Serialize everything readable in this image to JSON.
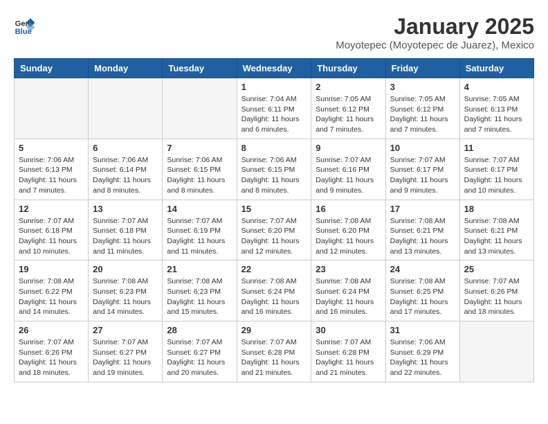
{
  "header": {
    "logo": {
      "general": "General",
      "blue": "Blue"
    },
    "title": "January 2025",
    "subtitle": "Moyotepec (Moyotepec de Juarez), Mexico"
  },
  "calendar": {
    "days": [
      "Sunday",
      "Monday",
      "Tuesday",
      "Wednesday",
      "Thursday",
      "Friday",
      "Saturday"
    ],
    "weeks": [
      [
        {
          "day": "",
          "info": ""
        },
        {
          "day": "",
          "info": ""
        },
        {
          "day": "",
          "info": ""
        },
        {
          "day": "1",
          "info": "Sunrise: 7:04 AM\nSunset: 6:11 PM\nDaylight: 11 hours and 6 minutes."
        },
        {
          "day": "2",
          "info": "Sunrise: 7:05 AM\nSunset: 6:12 PM\nDaylight: 11 hours and 7 minutes."
        },
        {
          "day": "3",
          "info": "Sunrise: 7:05 AM\nSunset: 6:12 PM\nDaylight: 11 hours and 7 minutes."
        },
        {
          "day": "4",
          "info": "Sunrise: 7:05 AM\nSunset: 6:13 PM\nDaylight: 11 hours and 7 minutes."
        }
      ],
      [
        {
          "day": "5",
          "info": "Sunrise: 7:06 AM\nSunset: 6:13 PM\nDaylight: 11 hours and 7 minutes."
        },
        {
          "day": "6",
          "info": "Sunrise: 7:06 AM\nSunset: 6:14 PM\nDaylight: 11 hours and 8 minutes."
        },
        {
          "day": "7",
          "info": "Sunrise: 7:06 AM\nSunset: 6:15 PM\nDaylight: 11 hours and 8 minutes."
        },
        {
          "day": "8",
          "info": "Sunrise: 7:06 AM\nSunset: 6:15 PM\nDaylight: 11 hours and 8 minutes."
        },
        {
          "day": "9",
          "info": "Sunrise: 7:07 AM\nSunset: 6:16 PM\nDaylight: 11 hours and 9 minutes."
        },
        {
          "day": "10",
          "info": "Sunrise: 7:07 AM\nSunset: 6:17 PM\nDaylight: 11 hours and 9 minutes."
        },
        {
          "day": "11",
          "info": "Sunrise: 7:07 AM\nSunset: 6:17 PM\nDaylight: 11 hours and 10 minutes."
        }
      ],
      [
        {
          "day": "12",
          "info": "Sunrise: 7:07 AM\nSunset: 6:18 PM\nDaylight: 11 hours and 10 minutes."
        },
        {
          "day": "13",
          "info": "Sunrise: 7:07 AM\nSunset: 6:18 PM\nDaylight: 11 hours and 11 minutes."
        },
        {
          "day": "14",
          "info": "Sunrise: 7:07 AM\nSunset: 6:19 PM\nDaylight: 11 hours and 11 minutes."
        },
        {
          "day": "15",
          "info": "Sunrise: 7:07 AM\nSunset: 6:20 PM\nDaylight: 11 hours and 12 minutes."
        },
        {
          "day": "16",
          "info": "Sunrise: 7:08 AM\nSunset: 6:20 PM\nDaylight: 11 hours and 12 minutes."
        },
        {
          "day": "17",
          "info": "Sunrise: 7:08 AM\nSunset: 6:21 PM\nDaylight: 11 hours and 13 minutes."
        },
        {
          "day": "18",
          "info": "Sunrise: 7:08 AM\nSunset: 6:21 PM\nDaylight: 11 hours and 13 minutes."
        }
      ],
      [
        {
          "day": "19",
          "info": "Sunrise: 7:08 AM\nSunset: 6:22 PM\nDaylight: 11 hours and 14 minutes."
        },
        {
          "day": "20",
          "info": "Sunrise: 7:08 AM\nSunset: 6:23 PM\nDaylight: 11 hours and 14 minutes."
        },
        {
          "day": "21",
          "info": "Sunrise: 7:08 AM\nSunset: 6:23 PM\nDaylight: 11 hours and 15 minutes."
        },
        {
          "day": "22",
          "info": "Sunrise: 7:08 AM\nSunset: 6:24 PM\nDaylight: 11 hours and 16 minutes."
        },
        {
          "day": "23",
          "info": "Sunrise: 7:08 AM\nSunset: 6:24 PM\nDaylight: 11 hours and 16 minutes."
        },
        {
          "day": "24",
          "info": "Sunrise: 7:08 AM\nSunset: 6:25 PM\nDaylight: 11 hours and 17 minutes."
        },
        {
          "day": "25",
          "info": "Sunrise: 7:07 AM\nSunset: 6:26 PM\nDaylight: 11 hours and 18 minutes."
        }
      ],
      [
        {
          "day": "26",
          "info": "Sunrise: 7:07 AM\nSunset: 6:26 PM\nDaylight: 11 hours and 18 minutes."
        },
        {
          "day": "27",
          "info": "Sunrise: 7:07 AM\nSunset: 6:27 PM\nDaylight: 11 hours and 19 minutes."
        },
        {
          "day": "28",
          "info": "Sunrise: 7:07 AM\nSunset: 6:27 PM\nDaylight: 11 hours and 20 minutes."
        },
        {
          "day": "29",
          "info": "Sunrise: 7:07 AM\nSunset: 6:28 PM\nDaylight: 11 hours and 21 minutes."
        },
        {
          "day": "30",
          "info": "Sunrise: 7:07 AM\nSunset: 6:28 PM\nDaylight: 11 hours and 21 minutes."
        },
        {
          "day": "31",
          "info": "Sunrise: 7:06 AM\nSunset: 6:29 PM\nDaylight: 11 hours and 22 minutes."
        },
        {
          "day": "",
          "info": ""
        }
      ]
    ]
  }
}
